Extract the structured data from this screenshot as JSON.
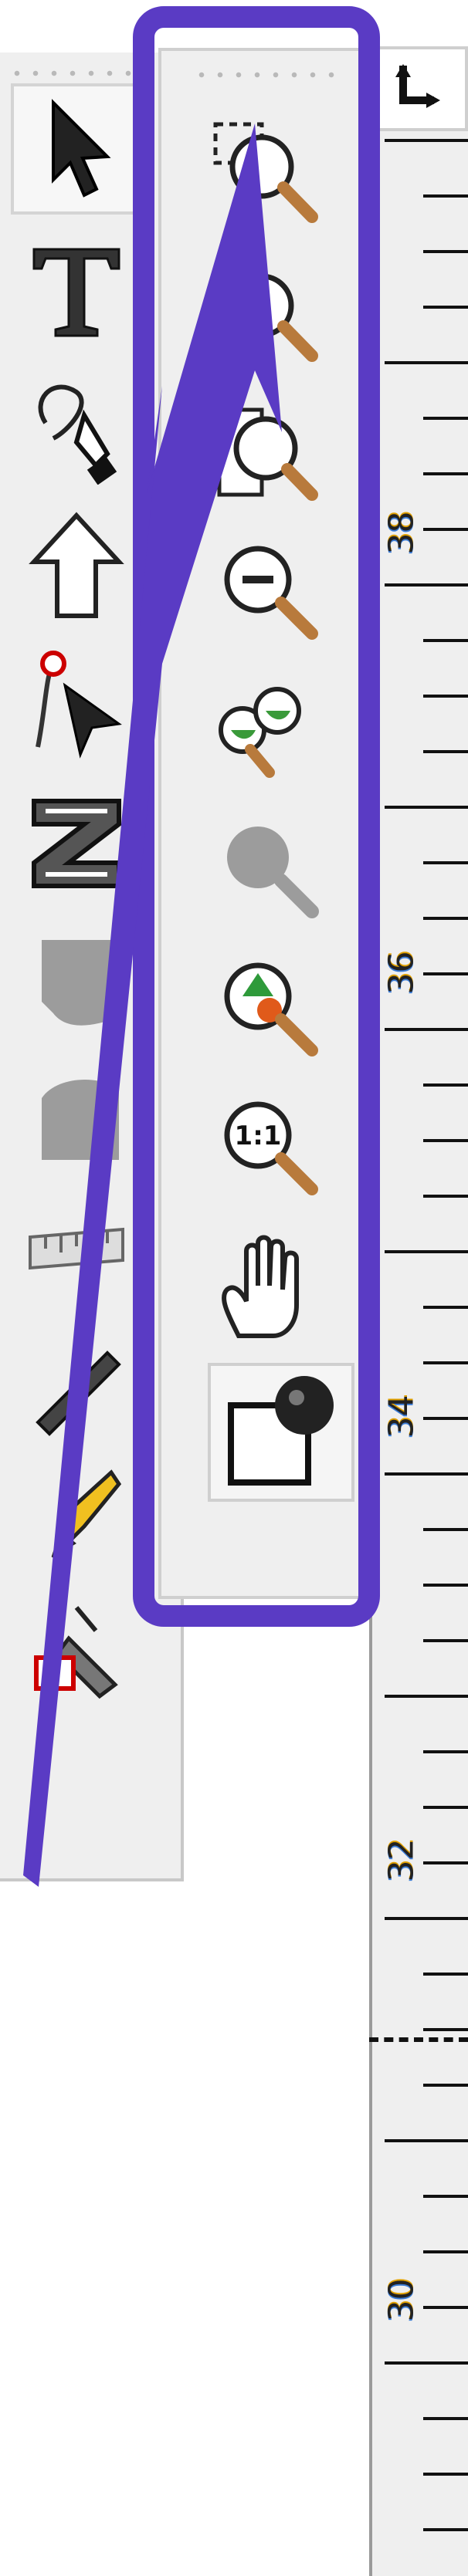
{
  "toolbox": {
    "tools": [
      {
        "name": "selector",
        "icon": "arrow-pointer-icon"
      },
      {
        "name": "text",
        "icon": "text-tool-icon"
      },
      {
        "name": "pen",
        "icon": "pen-tool-icon"
      },
      {
        "name": "arrow",
        "icon": "arrow-up-icon"
      },
      {
        "name": "node",
        "icon": "node-edit-icon"
      },
      {
        "name": "zigzag",
        "icon": "zigzag-icon"
      },
      {
        "name": "shape1",
        "icon": "shape-gray-icon"
      },
      {
        "name": "shape2",
        "icon": "shape-gray-icon"
      },
      {
        "name": "measure",
        "icon": "ruler-icon"
      },
      {
        "name": "calligraphy",
        "icon": "calligraphy-icon"
      },
      {
        "name": "pencil",
        "icon": "pencil-icon"
      },
      {
        "name": "eraser",
        "icon": "eraser-icon"
      }
    ]
  },
  "zoombar": {
    "tools": [
      {
        "name": "zoom-selection",
        "icon": "zoom-selection-icon"
      },
      {
        "name": "zoom-drawing",
        "icon": "zoom-drawing-icon"
      },
      {
        "name": "zoom-page",
        "icon": "zoom-page-icon"
      },
      {
        "name": "zoom-out",
        "icon": "zoom-out-icon"
      },
      {
        "name": "zoom-in-out",
        "icon": "zoom-double-icon"
      },
      {
        "name": "zoom-disabled",
        "icon": "zoom-disabled-icon"
      },
      {
        "name": "zoom-prev",
        "icon": "zoom-prev-icon"
      },
      {
        "name": "zoom-1-1",
        "icon": "zoom-1-1-icon",
        "label": "1:1"
      },
      {
        "name": "pan",
        "icon": "hand-icon"
      },
      {
        "name": "color-swatch",
        "icon": "color-swatch-icon"
      }
    ]
  },
  "ruler": {
    "labels": [
      {
        "text": "38"
      },
      {
        "text": "36"
      },
      {
        "text": "34"
      },
      {
        "text": "32"
      },
      {
        "text": "30"
      }
    ]
  },
  "colors": {
    "highlight": "#5a3bc4",
    "panel": "#efefef"
  }
}
